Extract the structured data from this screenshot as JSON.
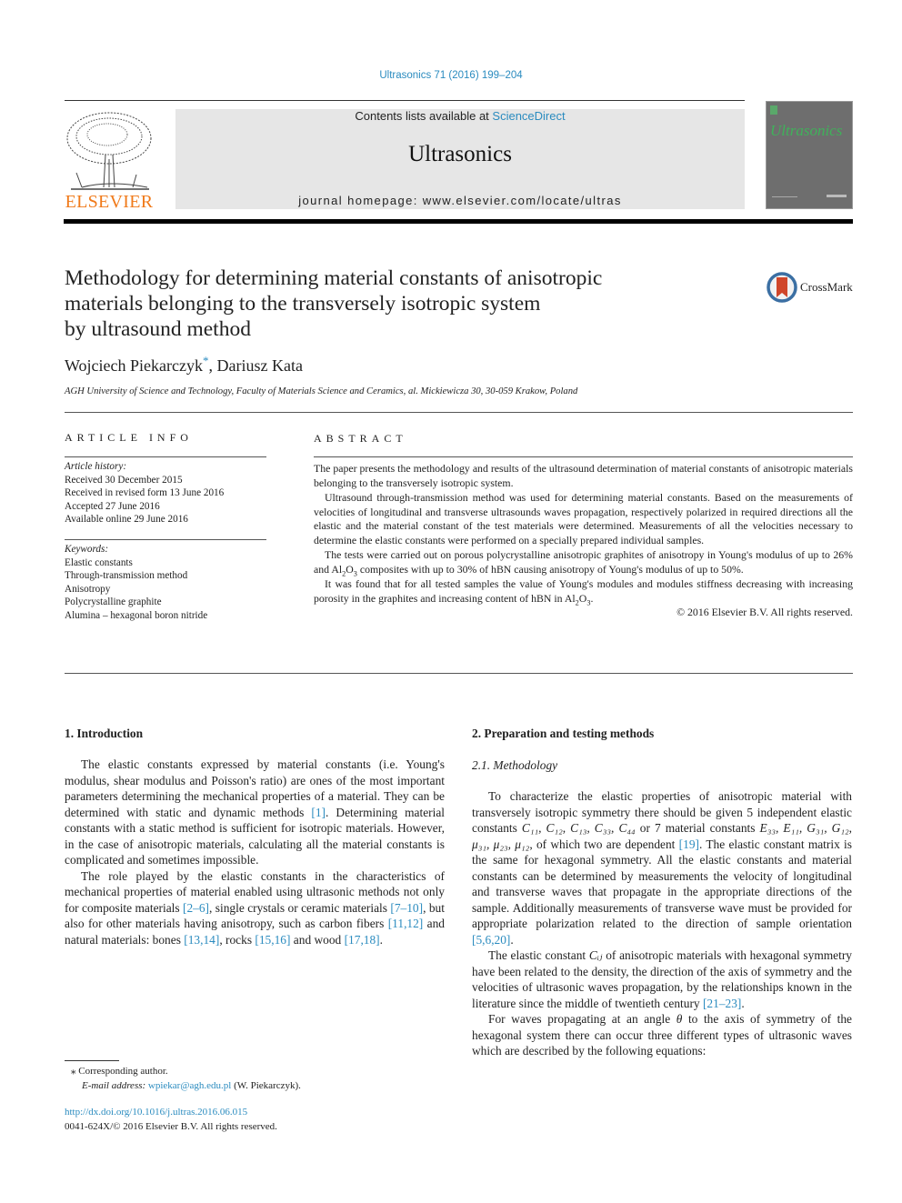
{
  "header": {
    "citation": "Ultrasonics 71 (2016) 199–204",
    "contents_prefix": "Contents lists available at ",
    "contents_link": "ScienceDirect",
    "journal_name": "Ultrasonics",
    "homepage": "journal homepage: www.elsevier.com/locate/ultras",
    "publisher_logo_text": "ELSEVIER",
    "cover_title": "Ultrasonics",
    "crossmark_label": "CrossMark"
  },
  "article": {
    "title_lines": [
      "Methodology for determining material constants of anisotropic",
      "materials belonging to the transversely isotropic system",
      "by ultrasound method"
    ],
    "authors": [
      {
        "name": "Wojciech Piekarczyk",
        "mark": "*"
      },
      {
        "name": "Dariusz Kata",
        "mark": ""
      }
    ],
    "author_separator": ", ",
    "affiliation": "AGH University of Science and Technology, Faculty of Materials Science and Ceramics, al. Mickiewicza 30, 30-059 Krakow, Poland"
  },
  "article_info": {
    "heading": "ARTICLE INFO",
    "history_label": "Article history:",
    "history": [
      "Received 30 December 2015",
      "Received in revised form 13 June 2016",
      "Accepted 27 June 2016",
      "Available online 29 June 2016"
    ],
    "keywords_label": "Keywords:",
    "keywords": [
      "Elastic constants",
      "Through-transmission method",
      "Anisotropy",
      "Polycrystalline graphite",
      "Alumina – hexagonal boron nitride"
    ]
  },
  "abstract": {
    "heading": "ABSTRACT",
    "p1": "The paper presents the methodology and results of the ultrasound determination of material constants of anisotropic materials belonging to the transversely isotropic system.",
    "p2": "Ultrasound through-transmission method was used for determining material constants. Based on the measurements of velocities of longitudinal and transverse ultrasounds waves propagation, respectively polarized in required directions all the elastic and the material constant of the test materials were determined. Measurements of all the velocities necessary to determine the elastic constants were performed on a specially prepared individual samples.",
    "p3_a": "The tests were carried out on porous polycrystalline anisotropic graphites of anisotropy in Young's modulus of up to 26% and Al",
    "p3_b": "O",
    "p3_c": " composites with up to 30% of hBN causing anisotropy of Young's modulus of up to 50%.",
    "p4_a": "It was found that for all tested samples the value of Young's modules and modules stiffness decreasing with increasing porosity in the graphites and increasing content of hBN in Al",
    "p4_b": "O",
    "p4_c": ".",
    "sub2": "2",
    "sub3": "3",
    "copyright": "© 2016 Elsevier B.V. All rights reserved."
  },
  "section1": {
    "heading": "1. Introduction",
    "p1_a": "The elastic constants expressed by material constants (i.e. Young's modulus, shear modulus and Poisson's ratio) are ones of the most important parameters determining the mechanical properties of a material. They can be determined with static and dynamic methods ",
    "p1_ref": "[1]",
    "p1_b": ". Determining material constants with a static method is sufficient for isotropic materials. However, in the case of anisotropic materials, calculating all the material constants is complicated and sometimes impossible.",
    "p2_a": "The role played by the elastic constants in the characteristics of mechanical properties of material enabled using ultrasonic methods not only for composite materials ",
    "p2_ref1": "[2–6]",
    "p2_b": ", single crystals or ceramic materials ",
    "p2_ref2": "[7–10]",
    "p2_c": ", but also for other materials having anisotropy, such as carbon fibers ",
    "p2_ref3": "[11,12]",
    "p2_d": " and natural materials: bones ",
    "p2_ref4": "[13,14]",
    "p2_e": ", rocks ",
    "p2_ref5": "[15,16]",
    "p2_f": " and wood ",
    "p2_ref6": "[17,18]",
    "p2_g": "."
  },
  "section2": {
    "heading": "2. Preparation and testing methods",
    "subheading": "2.1. Methodology",
    "p1_a": "To characterize the elastic properties of anisotropic material with transversely isotropic symmetry there should be given 5 independent elastic constants ",
    "elastic_constants": "C₁₁, C₁₂, C₁₃, C₃₃, C₄₄",
    "p1_b": " or 7 material constants ",
    "material_constants": "E₃₃, E₁₁, G₃₁, G₁₂, μ₃₁, μ₂₃, μ₁₂",
    "p1_c": ", of which two are dependent ",
    "p1_ref1": "[19]",
    "p1_d": ". The elastic constant matrix is the same for hexagonal symmetry. All the elastic constants and material constants can be determined by measurements the velocity of longitudinal and transverse waves that propagate in the appropriate directions of the sample. Additionally measurements of transverse wave must be provided for appropriate polarization related to the direction of sample orientation ",
    "p1_ref2": "[5,6,20]",
    "p1_e": ".",
    "p2_a": "The elastic constant ",
    "p2_sym": "Cᵢⱼ",
    "p2_b": " of anisotropic materials with hexagonal symmetry have been related to the density, the direction of the axis of symmetry and the velocities of ultrasonic waves propagation, by the relationships known in the literature since the middle of twentieth century ",
    "p2_ref": "[21–23]",
    "p2_c": ".",
    "p3_a": "For waves propagating at an angle ",
    "p3_sym": "θ",
    "p3_b": " to the axis of symmetry of the hexagonal system there can occur three different types of ultrasonic waves which are described by the following equations:"
  },
  "footnotes": {
    "mark": "⁎",
    "corresponding": "Corresponding author.",
    "email_label": "E-mail address: ",
    "email": "wpiekar@agh.edu.pl",
    "email_suffix": " (W. Piekarczyk).",
    "doi": "http://dx.doi.org/10.1016/j.ultras.2016.06.015",
    "issn_copyright": "0041-624X/© 2016 Elsevier B.V. All rights reserved."
  }
}
